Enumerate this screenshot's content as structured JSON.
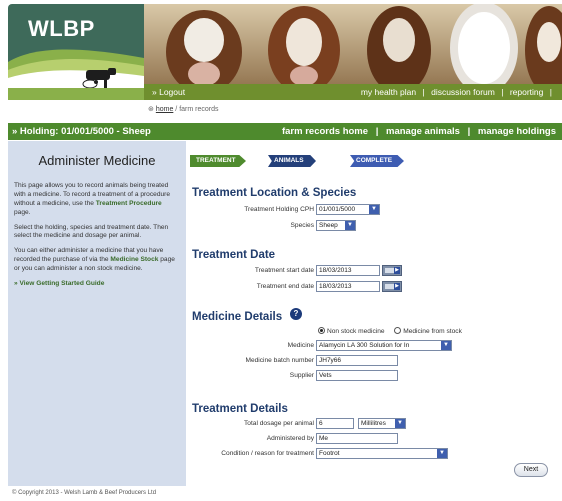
{
  "brand": {
    "logo_text": "WLBP"
  },
  "topnav": {
    "logout": "» Logout",
    "links": [
      "my health plan",
      "discussion forum",
      "reporting"
    ],
    "separator": "|"
  },
  "breadcrumb": {
    "home": "home",
    "sep": " / ",
    "current": "farm records"
  },
  "holding_bar": {
    "holding": "» Holding: 01/001/5000 - Sheep",
    "links": [
      "farm records home",
      "manage animals",
      "manage holdings"
    ],
    "separator": "|"
  },
  "sidebar": {
    "title": "Administer Medicine",
    "para1": "This page allows you to record animals being treated with a medicine. To record a treatment of a procedure without a medicine, use the",
    "para1_link": "Treatment Procedure",
    "para1_tail": " page.",
    "para2": "Select the holding, species and treatment date. Then select the medicine and dosage per animal.",
    "para3_a": "You can either administer a medicine that you have recorded the purchase of via the",
    "para3_link": "Medicine Stock",
    "para3_b": " page or you can administer a non stock medicine.",
    "guide": "» View Getting Started Guide"
  },
  "steps": [
    "TREATMENT",
    "ANIMALS",
    "COMPLETE"
  ],
  "location": {
    "title": "Treatment Location & Species",
    "cph_label": "Treatment Holding CPH",
    "cph_value": "01/001/5000",
    "species_label": "Species",
    "species_value": "Sheep"
  },
  "dates": {
    "title": "Treatment Date",
    "start_label": "Treatment start date",
    "start_value": "18/03/2013",
    "end_label": "Treatment end date",
    "end_value": "18/03/2013"
  },
  "medicine": {
    "title": "Medicine Details",
    "radio_nonstock": "Non stock medicine",
    "radio_stock": "Medicine from stock",
    "medicine_label": "Medicine",
    "medicine_value": "Alamycin LA 300 Solution for In",
    "batch_label": "Medicine batch number",
    "batch_value": "JH7y66",
    "supplier_label": "Supplier",
    "supplier_value": "Vets"
  },
  "treatment": {
    "title": "Treatment Details",
    "dosage_label": "Total dosage per animal",
    "dosage_value": "6",
    "unit_value": "Millilitres",
    "by_label": "Administered by",
    "by_value": "Me",
    "reason_label": "Condition / reason for treatment",
    "reason_value": "Footrot"
  },
  "next_label": "Next",
  "footer": "© Copyright 2013 - Welsh Lamb & Beef Producers Ltd"
}
